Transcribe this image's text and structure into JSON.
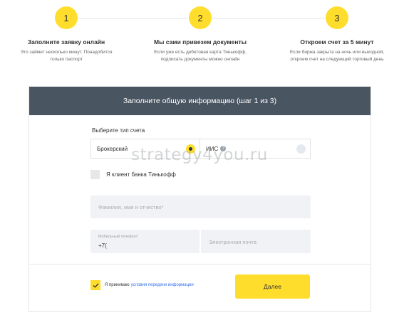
{
  "steps": [
    {
      "number": "1",
      "title": "Заполните заявку онлайн",
      "desc_line1": "Это займет несколько минут. Понадобится",
      "desc_line2": "только паспорт"
    },
    {
      "number": "2",
      "title": "Мы сами привезем документы",
      "desc_line1": "Если уже есть дебетовая карта Тинькофф,",
      "desc_line2": "подписать документы можно онлайн"
    },
    {
      "number": "3",
      "title": "Откроем счет за 5 минут",
      "desc_line1": "Если биржа закрыта на ночь или выходной,",
      "desc_line2": "откроем счет на следующий торговый день"
    }
  ],
  "form": {
    "header": "Заполните общую информацию (шаг 1 из 3)",
    "account_type_label": "Выберите тип счета",
    "account_options": [
      {
        "label": "Брокерский",
        "selected": true
      },
      {
        "label": "ИИС",
        "selected": false
      }
    ],
    "client_checkbox_label": "Я клиент банка Тинькофф",
    "client_checked": false,
    "fio_placeholder": "Фамилия, имя и отчество*",
    "phone_label": "Мобильный телефон*",
    "phone_value": "+7(",
    "email_placeholder": "Электронная почта",
    "agree_prefix": "Я принимаю",
    "agree_link": "условия передачи информации",
    "agree_checked": true,
    "next_button": "Далее"
  },
  "watermark": "strategy4you.ru",
  "colors": {
    "accent_yellow": "#ffdd2d",
    "header_bg": "#4a5562",
    "field_bg": "#f0f2f5",
    "link_blue": "#336fee"
  }
}
